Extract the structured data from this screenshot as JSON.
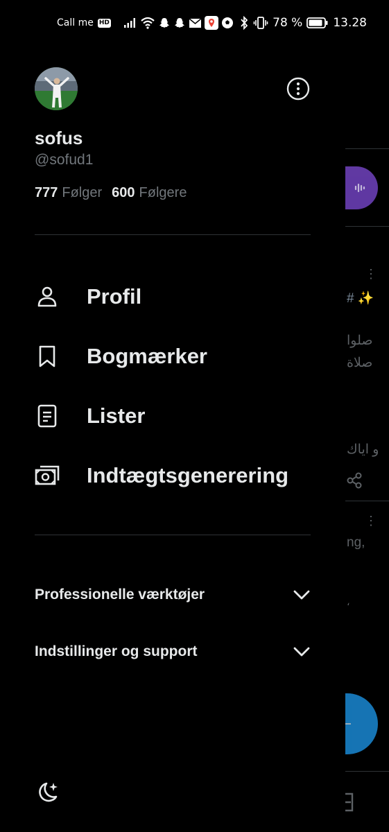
{
  "status_bar": {
    "carrier": "Call me",
    "hd_badge": "HD",
    "battery": "78 %",
    "time": "13.28"
  },
  "profile": {
    "display_name": "sofus",
    "handle": "@sofud1",
    "following_count": "777",
    "following_label": "Følger",
    "followers_count": "600",
    "followers_label": "Følgere"
  },
  "menu": [
    {
      "label": "Profil",
      "icon": "person-icon"
    },
    {
      "label": "Bogmærker",
      "icon": "bookmark-icon"
    },
    {
      "label": "Lister",
      "icon": "list-icon"
    },
    {
      "label": "Indtægtsgenerering",
      "icon": "money-icon"
    }
  ],
  "sections": [
    {
      "label": "Professionelle værktøjer",
      "icon": "chevron-down-icon"
    },
    {
      "label": "Indstillinger og support",
      "icon": "chevron-down-icon"
    }
  ],
  "background_feed": {
    "fragments": [
      "# ✨",
      "صلوا",
      "صلاة",
      "و اياك",
      "ng,",
      "،"
    ]
  },
  "colors": {
    "background": "#000000",
    "primary_text": "#e7e9ea",
    "secondary_text": "#71767b",
    "divider": "#2f3336",
    "spaces_purple": "#6a3fb4",
    "accent_blue": "#1d9bf0"
  }
}
